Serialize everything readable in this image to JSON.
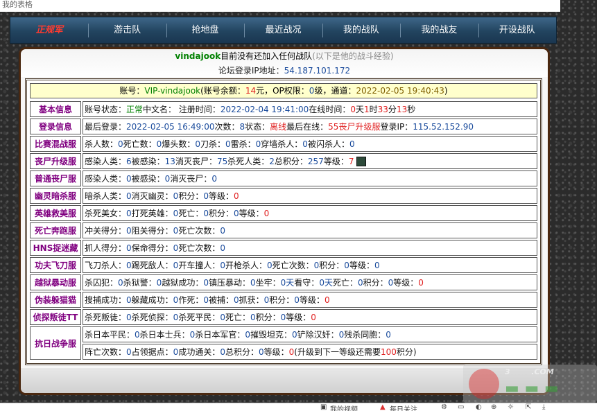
{
  "top_label": "我的表格",
  "nav": {
    "items": [
      "正规军",
      "游击队",
      "抢地盘",
      "最近战况",
      "我的战队",
      "我的战友",
      "开设战队"
    ],
    "active_index": 0
  },
  "header": {
    "username": "vindajook",
    "no_team_text": "目前没有还加入任何战队",
    "exp_text": "(以下是他的战斗经验)",
    "ip_label": "论坛登录IP地址：",
    "ip_value": "54.187.101.172"
  },
  "account": {
    "prefix": "账号：",
    "name": "VIP-vindajook",
    "balance_label": "(账号余额：",
    "balance_value": "14",
    "balance_unit": "元，OP权限：",
    "op_value": "0",
    "op_unit": "级，通道：",
    "time": "2022-02-05 19:40:43",
    "suffix": ")"
  },
  "rows": {
    "basic": {
      "cat": "基本信息",
      "p1": "账号状态：",
      "status": "正常",
      "p2": " 中文名：  注册时间：",
      "reg": "2022-02-04 19:41:00",
      "p3": " 在线时间：",
      "d": "0",
      "dl": "天",
      "h": "1",
      "hl": "时",
      "m": "33",
      "ml": "分",
      "s": "13",
      "sl": "秒"
    },
    "login": {
      "cat": "登录信息",
      "p1": "最后登录：",
      "last": "2022-02-05 16:49:00",
      "p2": " 次数：",
      "count": "8",
      "p3": " 状态：",
      "state": "离线",
      "p4": " 最后在线：",
      "server": "55丧尸升级服",
      "p5": " 登录IP：",
      "ip": "115.52.152.90"
    },
    "bisai": {
      "cat": "比赛混战服",
      "text1": "杀人数：",
      "v1": "0",
      "text2": " 死亡数：",
      "v2": "0",
      "text3": " 爆头数：",
      "v3": "0",
      "text4": " 刀杀：",
      "v4": "0",
      "text5": " 雷杀：",
      "v5": "0",
      "text6": " 穿墙杀人：",
      "v6": "0",
      "text7": " 被闪杀人：",
      "v7": "0"
    },
    "sangshi_up": {
      "cat": "丧尸升级服",
      "text1": "感染人类：",
      "v1": "6",
      "text2": " 被感染：",
      "v2": "13",
      "text3": " 消灭丧尸：",
      "v3": "75",
      "text4": " 杀死人类：",
      "v4": "2",
      "text5": " 总积分：",
      "v5": "257",
      "text6": " 等级：",
      "v6": "7"
    },
    "sangshi_normal": {
      "cat": "普通丧尸服",
      "text1": "感染人类：",
      "v1": "0",
      "text2": " 被感染：",
      "v2": "0",
      "text3": " 消灭丧尸：",
      "v3": "0"
    },
    "youling": {
      "cat": "幽灵暗杀服",
      "text1": "暗杀人类：",
      "v1": "0",
      "text2": " 消灭幽灵：",
      "v2": "0",
      "text3": " 积分：",
      "v3": "0",
      "text4": " 等级：",
      "v4": "0"
    },
    "yingxiong": {
      "cat": "英雄救美服",
      "text1": "杀死美女：",
      "v1": "0",
      "text2": " 打死英雄：",
      "v2": "0",
      "text3": " 死亡：",
      "v3": "0",
      "text4": " 积分：",
      "v4": "0",
      "text5": " 等级：",
      "v5": "0"
    },
    "siwang": {
      "cat": "死亡奔跑服",
      "text1": "冲关得分：",
      "v1": "0",
      "text2": " 阻关得分：",
      "v2": "0",
      "text3": " 死亡次数：",
      "v3": "0"
    },
    "hns": {
      "cat": "HNS捉迷藏",
      "text1": "抓人得分：",
      "v1": "0",
      "text2": " 保命得分：",
      "v2": "0",
      "text3": " 死亡次数：",
      "v3": "0"
    },
    "gongfu": {
      "cat": "功夫飞刀服",
      "text1": "飞刀杀人：",
      "v1": "0",
      "text2": " 踢死敌人：",
      "v2": "0",
      "text3": " 开车撞人：",
      "v3": "0",
      "text4": " 开枪杀人：",
      "v4": "0",
      "text5": " 死亡次数：",
      "v5": "0",
      "text6": " 积分：",
      "v6": "0",
      "text7": " 等级：",
      "v7": "0"
    },
    "yueyu": {
      "cat": "越狱暴动服",
      "text1": "杀囚犯：",
      "v1": "0",
      "text2": " 杀狱警：",
      "v2": "0",
      "text3": " 越狱成功：",
      "v3": "0",
      "text4": " 镇压暴动：",
      "v4": "0",
      "text5": " 坐牢：",
      "v5": "0",
      "u5": "天",
      "text6": " 看守：",
      "v6": "0",
      "u6": "天",
      "text7": " 死亡：",
      "v7": "0",
      "text8": " 积分：",
      "v8": "0",
      "text9": " 等级：",
      "v9": "0"
    },
    "weizhuang": {
      "cat": "伪装躲猫猫",
      "text1": "搜捕成功：",
      "v1": "0",
      "text2": " 躲藏成功：",
      "v2": "0",
      "text3": " 作死：",
      "v3": "0",
      "text4": " 被捕：",
      "v4": "0",
      "text5": " 抓获：",
      "v5": "0",
      "text6": " 积分：",
      "v6": "0",
      "text7": " 等级：",
      "v7": "0"
    },
    "zhentan": {
      "cat": "侦探叛徒TT",
      "text1": "杀死叛徒：",
      "v1": "0",
      "text2": " 杀死侦探：",
      "v2": "0",
      "text3": " 杀死平民：",
      "v3": "0",
      "text4": " 死亡：",
      "v4": "0",
      "text5": " 积分：",
      "v5": "0",
      "text6": " 等级：",
      "v6": "0"
    },
    "kangri": {
      "cat": "抗日战争服",
      "line1": {
        "text1": "杀日本平民：",
        "v1": "0",
        "text2": " 杀日本士兵：",
        "v2": "0",
        "text3": " 杀日本军官：",
        "v3": "0",
        "text4": " 摧毁坦克：",
        "v4": "0",
        "text5": " 铲除汉奸：",
        "v5": "0",
        "text6": " 残杀同胞：",
        "v6": "0"
      },
      "line2": {
        "text1": "阵亡次数：",
        "v1": "0",
        "text2": " 占领据点：",
        "v2": "0",
        "text3": " 成功通关：",
        "v3": "0",
        "text4": " 总积分：",
        "v4": "0",
        "text5": " 等级：",
        "v5": "0",
        "text6": " (升级到下一等级还需要",
        "v6": "100",
        "text7": "积分)"
      }
    }
  },
  "bottom_bar": [
    "我的视频",
    "每日关注"
  ],
  "colors": {
    "nav_bg": "#22445f",
    "nav_active": "#ff3b2f",
    "panel_border": "#4a2810",
    "category_text": "#800080",
    "value_blue": "#1a4b9c",
    "value_red": "#e02020",
    "value_green": "#008000",
    "account_bg": "#ffffcc"
  }
}
